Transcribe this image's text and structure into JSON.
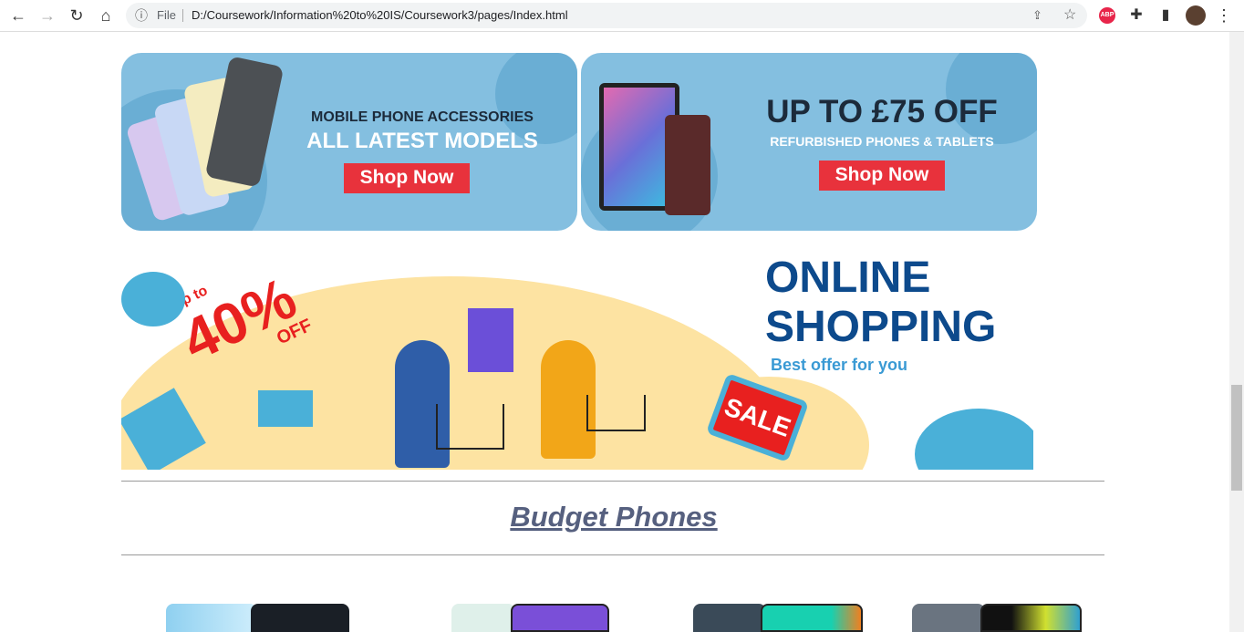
{
  "browser": {
    "url_scheme_label": "File",
    "url": "D:/Coursework/Information%20to%20IS/Coursework3/pages/Index.html",
    "extension_badge": "ABP"
  },
  "banners": [
    {
      "line1": "MOBILE PHONE ACCESSORIES",
      "line2": "ALL LATEST MODELS",
      "button": "Shop Now"
    },
    {
      "line1": "UP TO £75 OFF",
      "line2": "REFURBISHED PHONES & TABLETS",
      "button": "Shop Now"
    }
  ],
  "hero": {
    "discount_prefix": "Up to",
    "discount": "40%",
    "discount_suffix": "OFF",
    "title1": "ONLINE",
    "title2": "SHOPPING",
    "subtitle": "Best offer for you",
    "tag": "SALE"
  },
  "section": {
    "title": "Budget Phones"
  },
  "colors": {
    "banner_bg": "#84bfe0",
    "button_red": "#e8323c",
    "heading": "#56607f",
    "hero_blue": "#0d4a8c"
  }
}
